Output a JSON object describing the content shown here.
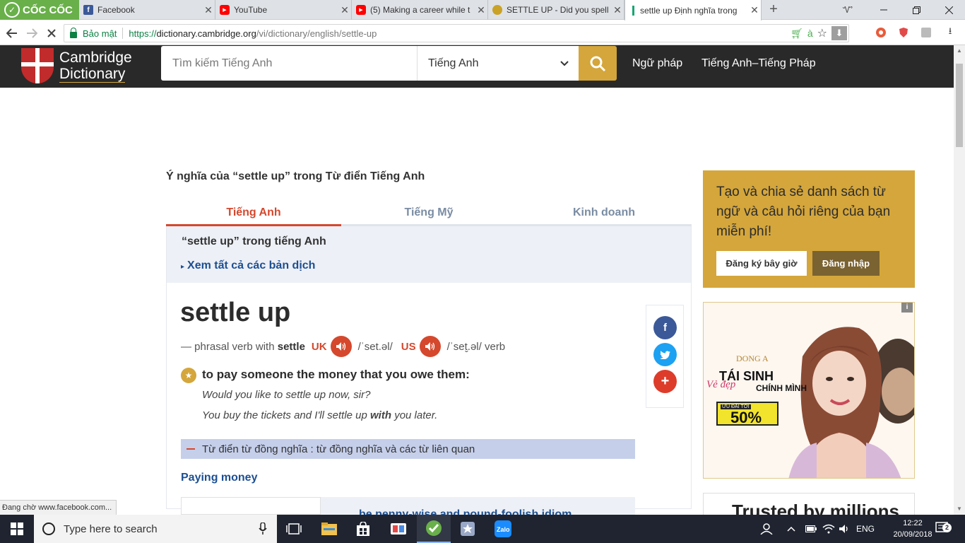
{
  "browser": {
    "brand": "CỐC CỐC",
    "tabs": [
      {
        "title": "Facebook",
        "icon": "facebook-icon",
        "color": "#3b5998"
      },
      {
        "title": "YouTube",
        "icon": "youtube-icon",
        "color": "#ff0000"
      },
      {
        "title": "(5) Making a career while t",
        "icon": "youtube-icon",
        "color": "#ff0000"
      },
      {
        "title": "SETTLE UP - Did you spell i",
        "icon": "bee-icon",
        "color": "#c9a227"
      },
      {
        "title": "settle up Định nghĩa trong",
        "icon": "cambridge-icon",
        "color": "#17a673"
      }
    ],
    "secure_label": "Bảo mật",
    "url_proto": "https://",
    "url_host": "dictionary.cambridge.org",
    "url_path": "/vi/dictionary/english/settle-up",
    "status_text": "Đang chờ www.facebook.com..."
  },
  "site": {
    "logo_line1": "Cambridge",
    "logo_line2": "Dictionary",
    "search_placeholder": "Tìm kiếm Tiếng Anh",
    "dictionary_select": "Tiếng Anh",
    "nav": [
      "Ngữ pháp",
      "Tiếng Anh–Tiếng Pháp"
    ]
  },
  "entry": {
    "meaning_heading": "Ý nghĩa của “settle up” trong Từ điển Tiếng Anh",
    "tabs": [
      "Tiếng Anh",
      "Tiếng Mỹ",
      "Kinh doanh"
    ],
    "header_title": "“settle up” trong tiếng Anh",
    "see_all": "Xem tất cả các bản dịch",
    "headword": "settle up",
    "pos_prefix": "— phrasal verb with",
    "pos_base": "settle",
    "uk_label": "UK",
    "uk_ipa": "/ˈset.əl/",
    "us_label": "US",
    "us_ipa": "/ˈset̬.əl/ verb",
    "definition": "to pay someone the money that you owe them:",
    "example1": "Would you like to settle up now, sir?",
    "example2_pre": "You buy the tickets and I'll settle up",
    "example2_bold": "with",
    "example2_post": "you later.",
    "synonym_bar": "Từ điển từ đồng nghĩa : từ đồng nghĩa và các từ liên quan",
    "topic": "Paying money",
    "next_idiom": "be penny-wise and pound-foolish idiom"
  },
  "sidebar": {
    "promo_text": "Tạo và chia sẻ danh sách từ ngữ và câu hỏi riêng của bạn miễn phí!",
    "register_button": "Đăng ký bây giờ",
    "login_button": "Đăng nhập",
    "ad": {
      "brand": "DONG A",
      "line1": "TÁI SINH",
      "line2": "Vẻ đẹp",
      "line3": "CHÍNH MÌNH",
      "offer_label": "ƯU ĐÃI TỚI",
      "offer_value": "50%",
      "info": "i"
    },
    "trusted": "Trusted by millions"
  },
  "taskbar": {
    "search_placeholder": "Type here to search",
    "language": "ENG",
    "time": "12:22",
    "date": "20/09/2018",
    "notifications": "2"
  },
  "colors": {
    "accent_red": "#d5482d",
    "gold": "#d4a63b",
    "link_blue": "#1d4f91",
    "header_bg": "#292929"
  }
}
